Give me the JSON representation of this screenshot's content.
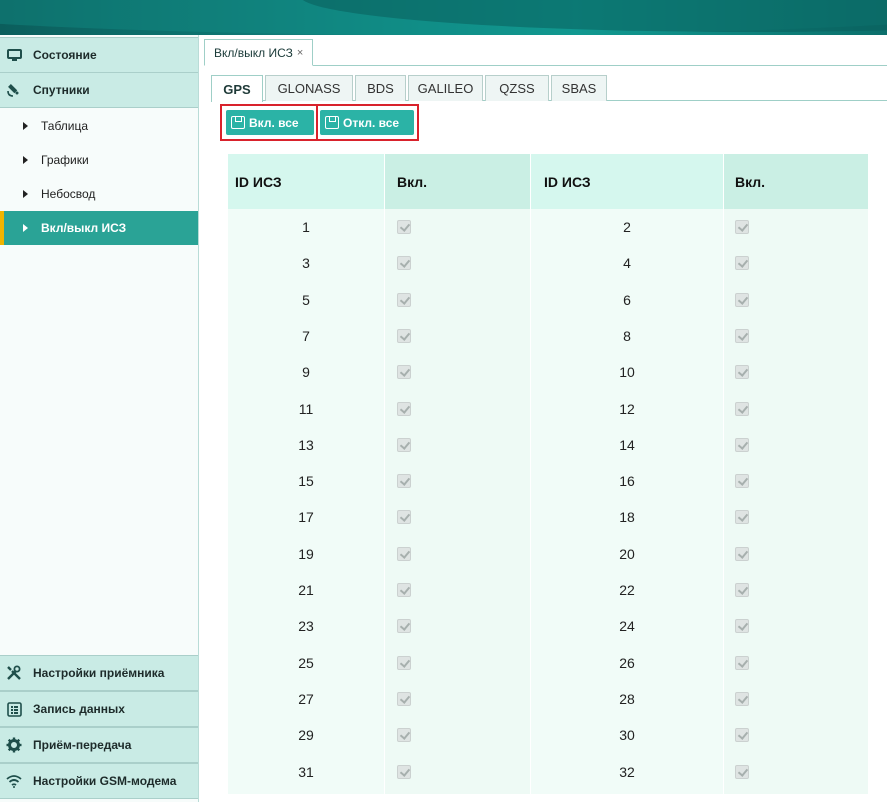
{
  "sidebar": {
    "top_groups": [
      {
        "label": "Состояние",
        "icon": "monitor-icon"
      },
      {
        "label": "Спутники",
        "icon": "satellite-icon"
      }
    ],
    "sub_items": [
      {
        "label": "Таблица"
      },
      {
        "label": "Графики"
      },
      {
        "label": "Небосвод"
      },
      {
        "label": "Вкл/выкл ИСЗ",
        "active": true
      }
    ],
    "bottom_groups": [
      {
        "label": "Настройки приёмника",
        "icon": "tools-icon"
      },
      {
        "label": "Запись данных",
        "icon": "list-icon"
      },
      {
        "label": "Приём-передача",
        "icon": "gear-icon"
      },
      {
        "label": "Настройки GSM-модема",
        "icon": "wifi-icon"
      }
    ]
  },
  "panel_tab": {
    "label": "Вкл/выкл ИСЗ",
    "close": "×"
  },
  "system_tabs": [
    "GPS",
    "GLONASS",
    "BDS",
    "GALILEO",
    "QZSS",
    "SBAS"
  ],
  "active_system": "GPS",
  "buttons": {
    "enable_all": "Вкл. все",
    "disable_all": "Откл. все"
  },
  "table": {
    "headers": [
      "ID ИСЗ",
      "Вкл.",
      "ID ИСЗ",
      "Вкл."
    ],
    "rows": [
      [
        "1",
        "2"
      ],
      [
        "3",
        "4"
      ],
      [
        "5",
        "6"
      ],
      [
        "7",
        "8"
      ],
      [
        "9",
        "10"
      ],
      [
        "11",
        "12"
      ],
      [
        "13",
        "14"
      ],
      [
        "15",
        "16"
      ],
      [
        "17",
        "18"
      ],
      [
        "19",
        "20"
      ],
      [
        "21",
        "22"
      ],
      [
        "23",
        "24"
      ],
      [
        "25",
        "26"
      ],
      [
        "27",
        "28"
      ],
      [
        "29",
        "30"
      ],
      [
        "31",
        "32"
      ]
    ],
    "all_checked_disabled": true
  },
  "colors": {
    "accent": "#2aa396",
    "active_marker": "#f0b400",
    "button": "#2bb3a6",
    "highlight_outline": "#d9222c"
  }
}
